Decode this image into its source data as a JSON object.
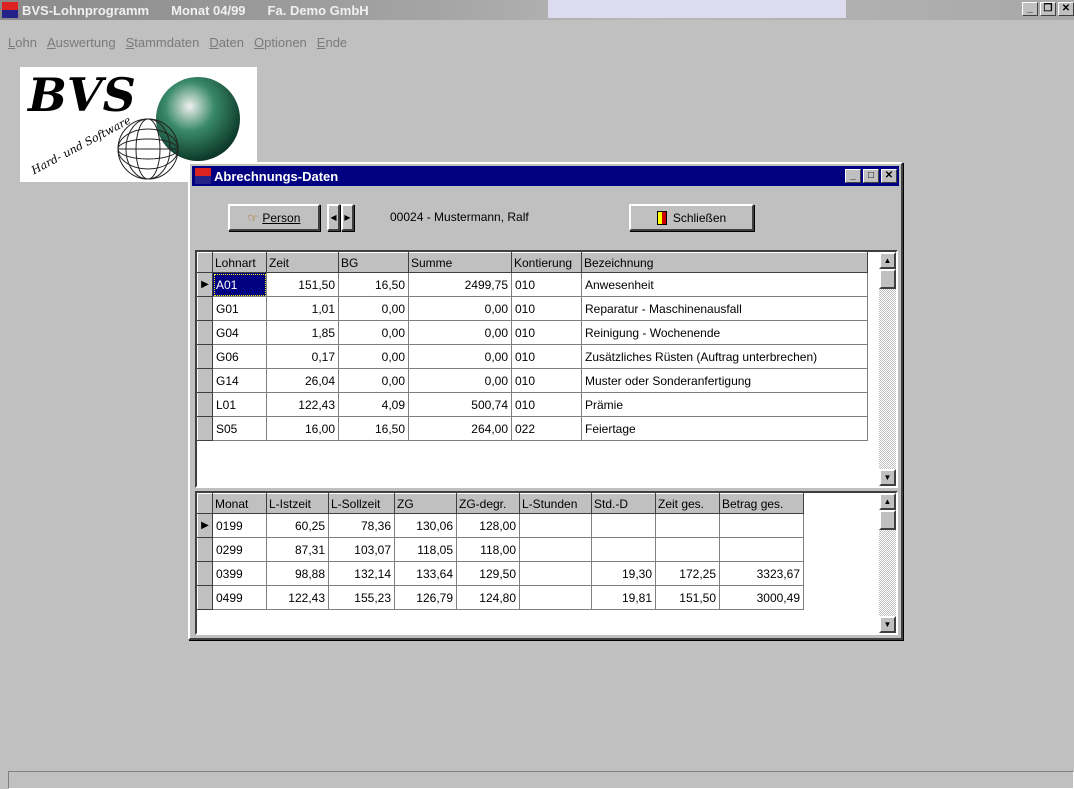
{
  "app": {
    "title_app": "BVS-Lohnprogramm",
    "title_month": "Monat 04/99",
    "title_company": "Fa. Demo GmbH",
    "icon_text": "BVS",
    "window_buttons": [
      "_",
      "ƈ",
      "X"
    ]
  },
  "menu": [
    "Lohn",
    "Auswertung",
    "Stammdaten",
    "Daten",
    "Optionen",
    "Ende"
  ],
  "logo": {
    "text": "BVS",
    "subtitle": "Hard- und Software"
  },
  "dialog": {
    "title": "Abrechnungs-Daten",
    "person_button": "Person",
    "person_value": "00024 - Mustermann, Ralf",
    "close_button": "Schließen"
  },
  "grid1": {
    "columns": [
      "Lohnart",
      "Zeit",
      "BG",
      "Summe",
      "Kontierung",
      "Bezeichnung"
    ],
    "rows": [
      [
        "A01",
        "151,50",
        "16,50",
        "2499,75",
        "010",
        "Anwesenheit"
      ],
      [
        "G01",
        "1,01",
        "0,00",
        "0,00",
        "010",
        "Reparatur - Maschinenausfall"
      ],
      [
        "G04",
        "1,85",
        "0,00",
        "0,00",
        "010",
        "Reinigung - Wochenende"
      ],
      [
        "G06",
        "0,17",
        "0,00",
        "0,00",
        "010",
        "Zusätzliches Rüsten (Auftrag unterbrechen)"
      ],
      [
        "G14",
        "26,04",
        "0,00",
        "0,00",
        "010",
        "Muster oder Sonderanfertigung"
      ],
      [
        "L01",
        "122,43",
        "4,09",
        "500,74",
        "010",
        "Prämie"
      ],
      [
        "S05",
        "16,00",
        "16,50",
        "264,00",
        "022",
        "Feiertage"
      ]
    ]
  },
  "grid2": {
    "columns": [
      "Monat",
      "L-Istzeit",
      "L-Sollzeit",
      "ZG",
      "ZG-degr.",
      "L-Stunden",
      "Std.-D",
      "Zeit ges.",
      "Betrag ges."
    ],
    "rows": [
      [
        "0199",
        "60,25",
        "78,36",
        "130,06",
        "128,00",
        "",
        "",
        "",
        ""
      ],
      [
        "0299",
        "87,31",
        "103,07",
        "118,05",
        "118,00",
        "",
        "",
        "",
        ""
      ],
      [
        "0399",
        "98,88",
        "132,14",
        "133,64",
        "129,50",
        "",
        "19,30",
        "172,25",
        "3323,67"
      ],
      [
        "0499",
        "122,43",
        "155,23",
        "126,79",
        "124,80",
        "",
        "19,81",
        "151,50",
        "3000,49"
      ]
    ]
  }
}
